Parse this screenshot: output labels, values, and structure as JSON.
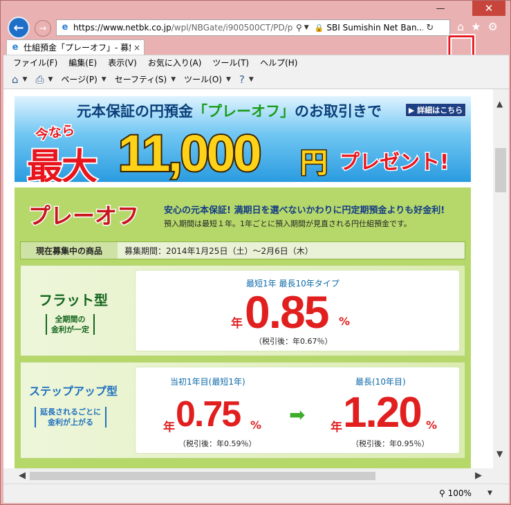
{
  "window": {
    "minimize": "—",
    "maximize": "☐",
    "close": "✕"
  },
  "address": {
    "url_host": "https://www.netbk.co.jp",
    "url_rest": "/wpl/NBGate/i900500CT/PD/p",
    "site_identity": "SBI Sumishin Net Ban..."
  },
  "tab": {
    "label": "仕組預金「プレーオフ」- 募集...",
    "close": "×"
  },
  "menu": [
    "ファイル(F)",
    "編集(E)",
    "表示(V)",
    "お気に入り(A)",
    "ツール(T)",
    "ヘルプ(H)"
  ],
  "command_bar": {
    "page": "ページ(P)",
    "safety": "セーフティ(S)",
    "tools": "ツール(O)"
  },
  "banner": {
    "headline_before": "元本保証の円預金",
    "headline_product": "「プレーオフ」",
    "headline_after": "のお取引きで",
    "detail_button": "詳細はこちら",
    "now": "今なら",
    "max": "最大",
    "amount": "11,000",
    "yen": "円",
    "present": "プレゼント!"
  },
  "product": {
    "title": "プレーオフ",
    "lead": "安心の元本保証! 満期日を選べないかわりに円定期預金よりも好金利!",
    "sub": "預入期間は最短１年。1年ごとに預入期間が見直される円仕組預金です。",
    "recruit_label": "現在募集中の商品",
    "recruit_period": "募集期間：2014年1月25日（土）～2月6日（木）",
    "flat": {
      "name": "フラット型",
      "note_line1": "全期間の",
      "note_line2": "金利が一定",
      "term": "最短1年 最長10年タイプ",
      "year_label": "年",
      "rate": "0.85",
      "percent": "%",
      "after_tax": "（税引後：年0.67％）"
    },
    "step": {
      "name": "ステップアップ型",
      "note_line1": "延長されるごとに",
      "note_line2": "金利が上がる",
      "first_label": "当初1年目(最短1年)",
      "first_year": "年",
      "first_rate": "0.75",
      "first_pct": "%",
      "first_after": "（税引後：年0.59％）",
      "max_label": "最長(10年目)",
      "max_year": "年",
      "max_rate": "1.20",
      "max_pct": "%",
      "max_after": "（税引後：年0.95％）"
    }
  },
  "status": {
    "zoom": "100%"
  }
}
